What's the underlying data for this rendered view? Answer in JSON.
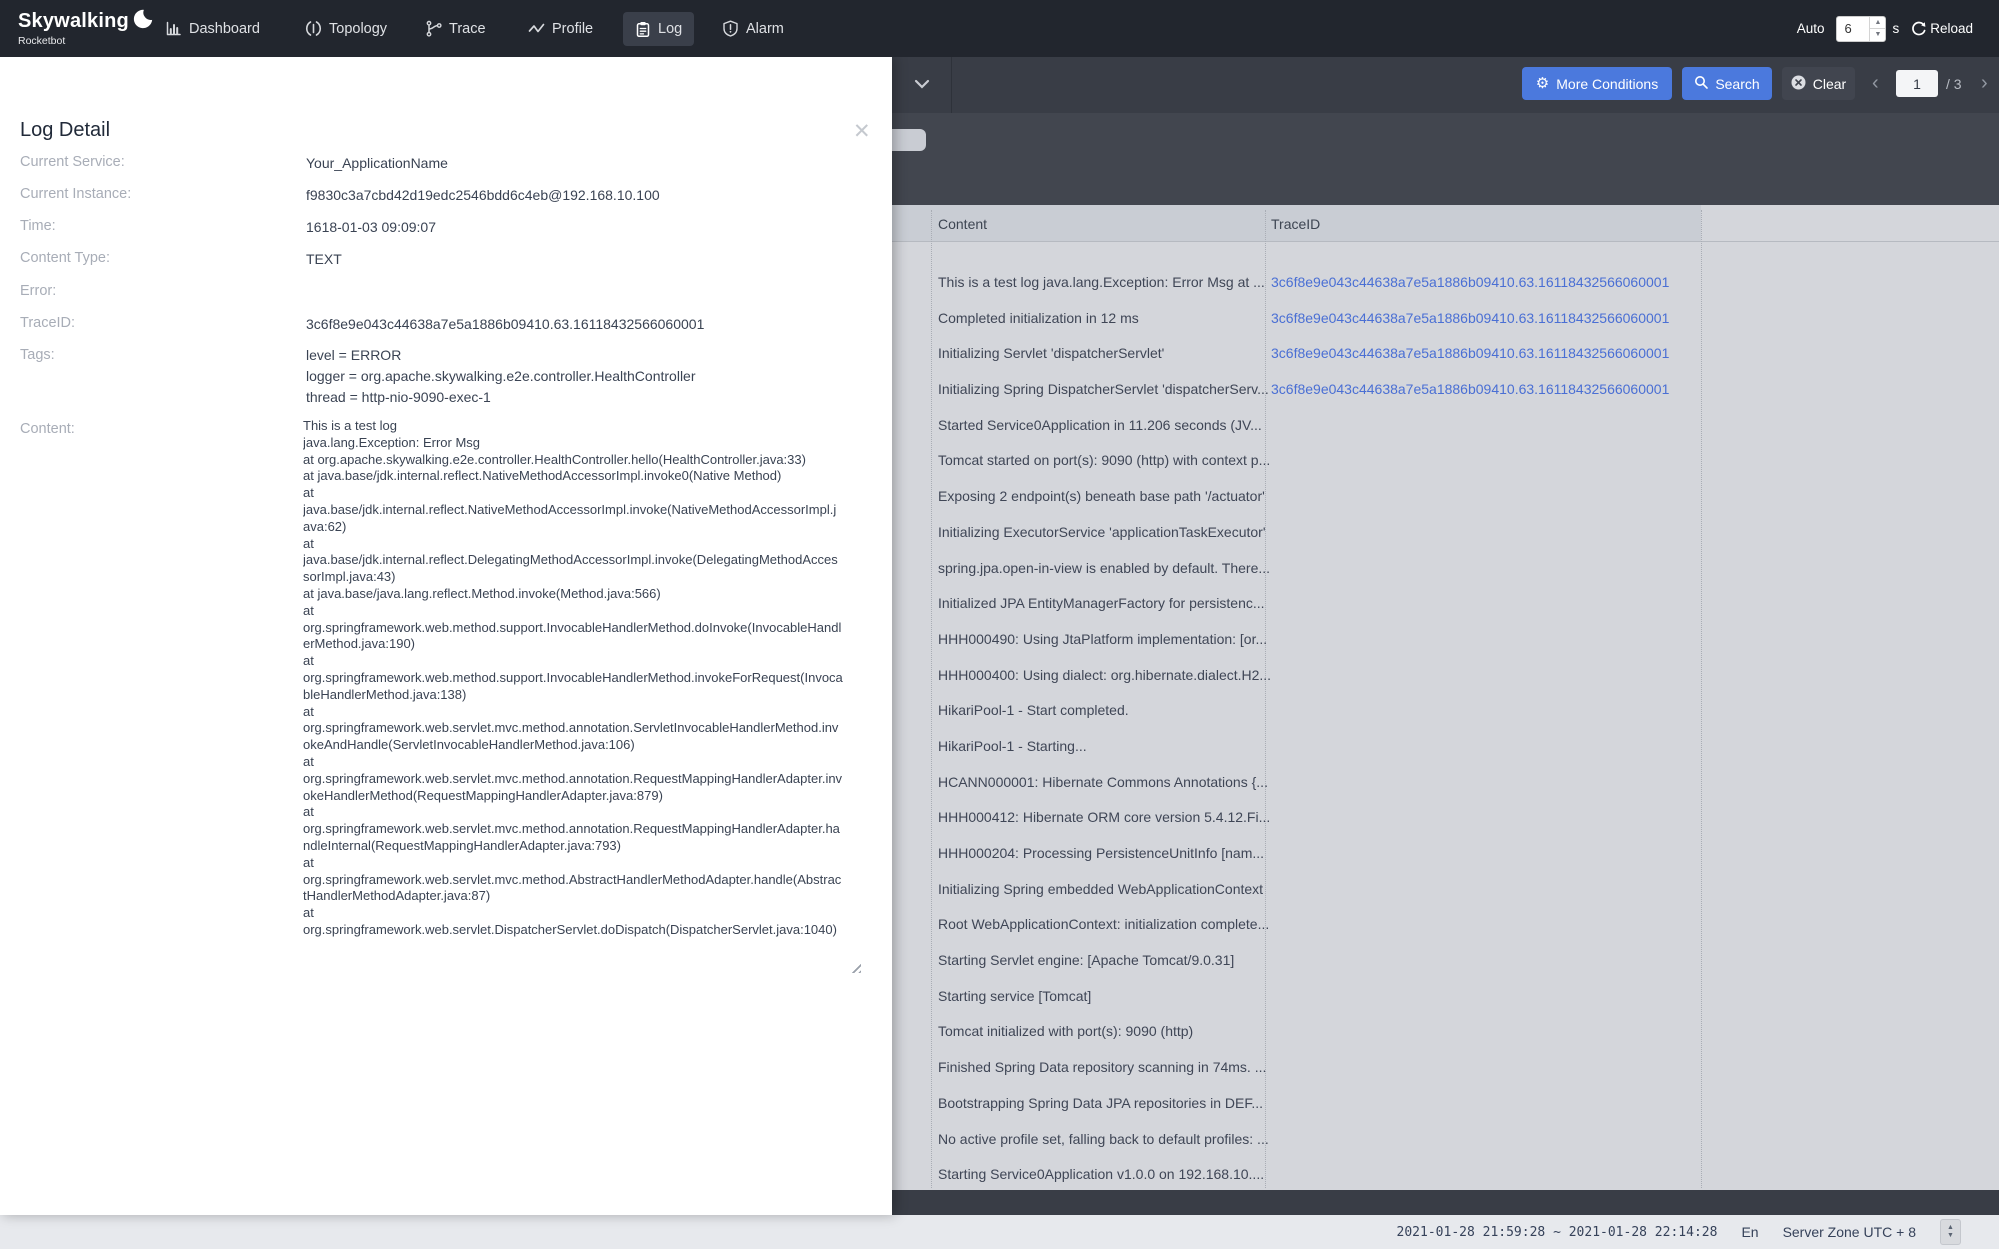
{
  "navbar": {
    "logo_title": "Skywalking",
    "logo_subtitle": "Rocketbot",
    "items": [
      {
        "label": "Dashboard"
      },
      {
        "label": "Topology"
      },
      {
        "label": "Trace"
      },
      {
        "label": "Profile"
      },
      {
        "label": "Log",
        "active": true
      },
      {
        "label": "Alarm"
      }
    ],
    "auto_label": "Auto",
    "auto_value": "6",
    "auto_unit": "s",
    "reload_label": "Reload"
  },
  "toolbar": {
    "more_conditions_label": "More Conditions",
    "search_label": "Search",
    "clear_label": "Clear",
    "pagination": {
      "current": "1",
      "total_text": "/ 3"
    }
  },
  "modal": {
    "title": "Log Detail",
    "fields": [
      {
        "label": "Current Service:",
        "value": "Your_ApplicationName"
      },
      {
        "label": "Current Instance:",
        "value": "f9830c3a7cbd42d19edc2546bdd6c4eb@192.168.10.100"
      },
      {
        "label": "Time:",
        "value": "1618-01-03 09:09:07"
      },
      {
        "label": "Content Type:",
        "value": "TEXT"
      },
      {
        "label": "Error:",
        "value": ""
      },
      {
        "label": "TraceID:",
        "value": "3c6f8e9e043c44638a7e5a1886b09410.63.16118432566060001"
      }
    ],
    "tags_label": "Tags:",
    "tags": [
      "level = ERROR",
      "logger = org.apache.skywalking.e2e.controller.HealthController",
      "thread = http-nio-9090-exec-1"
    ],
    "content_label": "Content:",
    "content": "This is a test log\njava.lang.Exception: Error Msg\nat org.apache.skywalking.e2e.controller.HealthController.hello(HealthController.java:33)\nat java.base/jdk.internal.reflect.NativeMethodAccessorImpl.invoke0(Native Method)\nat java.base/jdk.internal.reflect.NativeMethodAccessorImpl.invoke(NativeMethodAccessorImpl.java:62)\nat java.base/jdk.internal.reflect.DelegatingMethodAccessorImpl.invoke(DelegatingMethodAccessorImpl.java:43)\nat java.base/java.lang.reflect.Method.invoke(Method.java:566)\nat org.springframework.web.method.support.InvocableHandlerMethod.doInvoke(InvocableHandlerMethod.java:190)\nat org.springframework.web.method.support.InvocableHandlerMethod.invokeForRequest(InvocableHandlerMethod.java:138)\nat org.springframework.web.servlet.mvc.method.annotation.ServletInvocableHandlerMethod.invokeAndHandle(ServletInvocableHandlerMethod.java:106)\nat org.springframework.web.servlet.mvc.method.annotation.RequestMappingHandlerAdapter.invokeHandlerMethod(RequestMappingHandlerAdapter.java:879)\nat org.springframework.web.servlet.mvc.method.annotation.RequestMappingHandlerAdapter.handleInternal(RequestMappingHandlerAdapter.java:793)\nat org.springframework.web.servlet.mvc.method.AbstractHandlerMethodAdapter.handle(AbstractHandlerMethodAdapter.java:87)\nat org.springframework.web.servlet.DispatcherServlet.doDispatch(DispatcherServlet.java:1040)"
  },
  "table": {
    "columns": [
      "Content",
      "TraceID"
    ],
    "rows": [
      {
        "content": "This is a test log java.lang.Exception: Error Msg at ...",
        "trace_id": "3c6f8e9e043c44638a7e5a1886b09410.63.16118432566060001"
      },
      {
        "content": "Completed initialization in 12 ms",
        "trace_id": "3c6f8e9e043c44638a7e5a1886b09410.63.16118432566060001"
      },
      {
        "content": "Initializing Servlet 'dispatcherServlet'",
        "trace_id": "3c6f8e9e043c44638a7e5a1886b09410.63.16118432566060001"
      },
      {
        "content": "Initializing Spring DispatcherServlet 'dispatcherServ...",
        "trace_id": "3c6f8e9e043c44638a7e5a1886b09410.63.16118432566060001"
      },
      {
        "content": "Started Service0Application in 11.206 seconds (JV...",
        "trace_id": ""
      },
      {
        "content": "Tomcat started on port(s): 9090 (http) with context p...",
        "trace_id": ""
      },
      {
        "content": "Exposing 2 endpoint(s) beneath base path '/actuator'",
        "trace_id": ""
      },
      {
        "content": "Initializing ExecutorService 'applicationTaskExecutor'",
        "trace_id": ""
      },
      {
        "content": "spring.jpa.open-in-view is enabled by default. There...",
        "trace_id": ""
      },
      {
        "content": "Initialized JPA EntityManagerFactory for persistenc...",
        "trace_id": ""
      },
      {
        "content": "HHH000490: Using JtaPlatform implementation: [or...",
        "trace_id": ""
      },
      {
        "content": "HHH000400: Using dialect: org.hibernate.dialect.H2...",
        "trace_id": ""
      },
      {
        "content": "HikariPool-1 - Start completed.",
        "trace_id": ""
      },
      {
        "content": "HikariPool-1 - Starting...",
        "trace_id": ""
      },
      {
        "content": "HCANN000001: Hibernate Commons Annotations {...",
        "trace_id": ""
      },
      {
        "content": "HHH000412: Hibernate ORM core version 5.4.12.Fi...",
        "trace_id": ""
      },
      {
        "content": "HHH000204: Processing PersistenceUnitInfo [nam...",
        "trace_id": ""
      },
      {
        "content": "Initializing Spring embedded WebApplicationContext",
        "trace_id": ""
      },
      {
        "content": "Root WebApplicationContext: initialization complete...",
        "trace_id": ""
      },
      {
        "content": "Starting Servlet engine: [Apache Tomcat/9.0.31]",
        "trace_id": ""
      },
      {
        "content": "Starting service [Tomcat]",
        "trace_id": ""
      },
      {
        "content": "Tomcat initialized with port(s): 9090 (http)",
        "trace_id": ""
      },
      {
        "content": "Finished Spring Data repository scanning in 74ms. ...",
        "trace_id": ""
      },
      {
        "content": "Bootstrapping Spring Data JPA repositories in DEF...",
        "trace_id": ""
      },
      {
        "content": "No active profile set, falling back to default profiles: ...",
        "trace_id": ""
      },
      {
        "content": "Starting Service0Application v1.0.0 on 192.168.10....",
        "trace_id": ""
      }
    ]
  },
  "footer": {
    "time_range": "2021-01-28 21:59:28 ~ 2021-01-28 22:14:28",
    "language": "En",
    "server_zone": "Server Zone UTC + 8"
  },
  "icons": {
    "close": "✕",
    "gear": "⚙",
    "chevron_left": "‹",
    "chevron_right": "›",
    "caret_up": "▲",
    "caret_down": "▼"
  },
  "colors": {
    "accent_blue": "#4b79dd",
    "link_blue": "#4a6fd4",
    "navbar_bg": "#22262e",
    "toolbar_bg": "#393d46",
    "subbar_bg": "#42464f",
    "table_header_bg": "#c9cdd4",
    "table_body_bg": "#d4d6db",
    "footer_bg": "#e7e9ed"
  }
}
